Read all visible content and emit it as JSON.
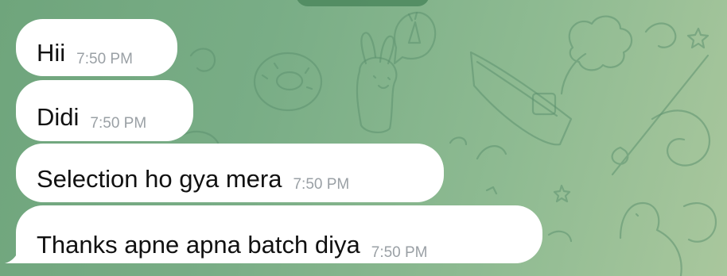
{
  "messages": [
    {
      "text": "Hii",
      "time": "7:50 PM"
    },
    {
      "text": "Didi",
      "time": "7:50 PM"
    },
    {
      "text": "Selection ho gya mera",
      "time": "7:50 PM"
    },
    {
      "text": "Thanks apne apna batch diya",
      "time": "7:50 PM"
    }
  ],
  "colors": {
    "bubble_background": "#ffffff",
    "message_text": "#111111",
    "time_text": "#9aa0a5",
    "wallpaper_green": "#79ad86",
    "wallpaper_pattern": "#5d9270"
  }
}
